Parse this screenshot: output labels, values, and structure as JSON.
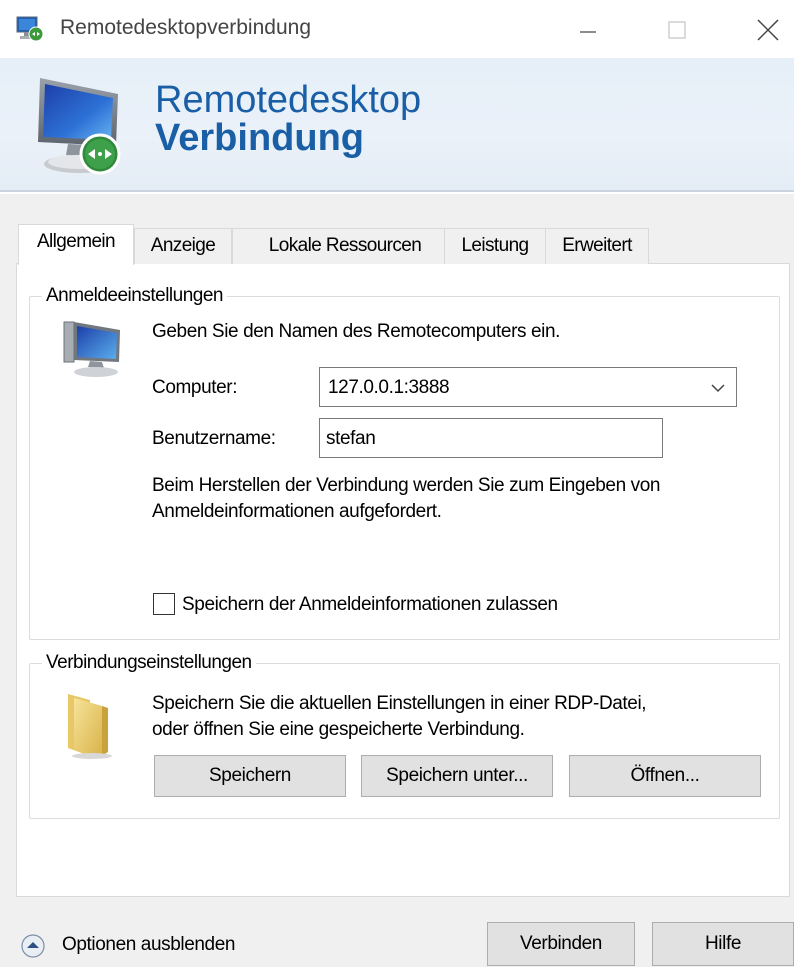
{
  "window": {
    "title": "Remotedesktopverbindung"
  },
  "banner": {
    "line1": "Remotedesktop",
    "line2": "Verbindung"
  },
  "tabs": [
    {
      "label": "Allgemein",
      "active": true
    },
    {
      "label": "Anzeige",
      "active": false
    },
    {
      "label": "Lokale Ressourcen",
      "active": false
    },
    {
      "label": "Leistung",
      "active": false
    },
    {
      "label": "Erweitert",
      "active": false
    }
  ],
  "login_group": {
    "legend": "Anmeldeeinstellungen",
    "instruction": "Geben Sie den Namen des Remotecomputers ein.",
    "computer_label": "Computer:",
    "computer_value": "127.0.0.1:3888",
    "username_label": "Benutzername:",
    "username_value": "stefan",
    "info_line1": "Beim Herstellen der Verbindung werden Sie zum Eingeben von",
    "info_line2": "Anmeldeinformationen aufgefordert.",
    "save_credentials_label": "Speichern der Anmeldeinformationen zulassen",
    "save_credentials_checked": false
  },
  "connection_group": {
    "legend": "Verbindungseinstellungen",
    "info_line1": "Speichern Sie die aktuellen Einstellungen in einer RDP-Datei,",
    "info_line2": "oder öffnen Sie eine gespeicherte Verbindung.",
    "save_label": "Speichern",
    "save_as_label": "Speichern unter...",
    "open_label": "Öffnen..."
  },
  "footer": {
    "options_label": "Optionen ausblenden",
    "connect_label": "Verbinden",
    "help_label": "Hilfe"
  },
  "colors": {
    "accent": "#1a5fa6",
    "banner_bg": "#e6eff8",
    "dialog_bg": "#f0f0f0",
    "button_bg": "#e1e1e1"
  }
}
